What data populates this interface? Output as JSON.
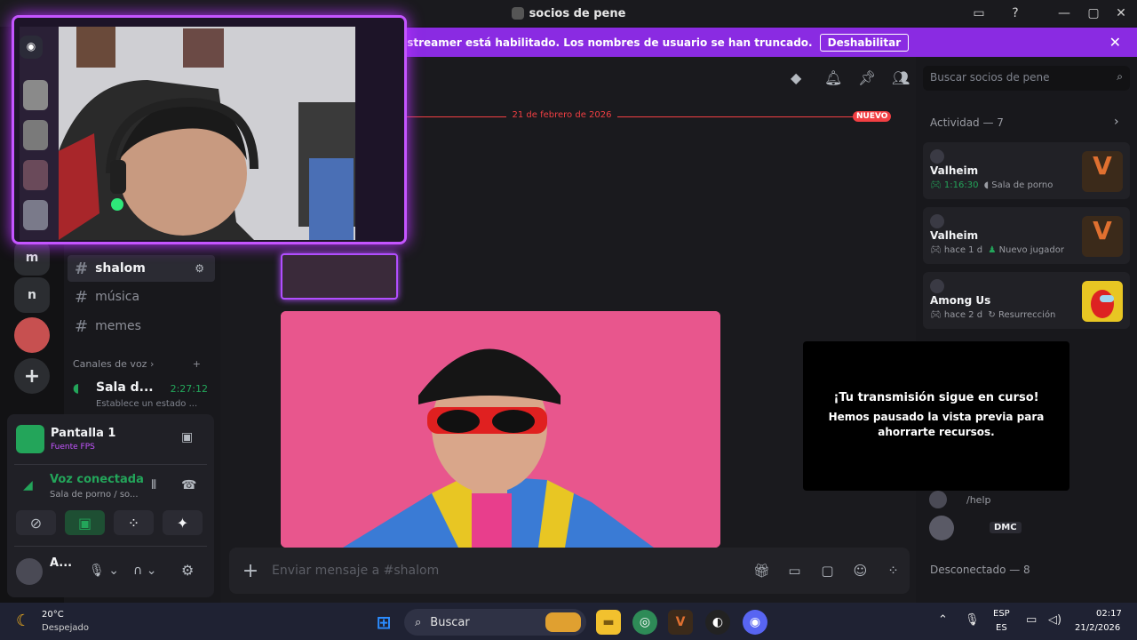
{
  "window": {
    "title": "socios de pene"
  },
  "banner": {
    "text": "El modo streamer está habilitado. Los nombres de usuario se han truncado.",
    "button": "Deshabilitar"
  },
  "rail": {
    "items": [
      "m",
      "n"
    ]
  },
  "channels": {
    "items": [
      {
        "label": "shalom",
        "active": true
      },
      {
        "label": "música"
      },
      {
        "label": "memes"
      }
    ],
    "voice_category": "Canales de voz",
    "voice_channel": {
      "label": "Sala d...",
      "timer": "2:27:12",
      "status": "Establece un estado ..."
    }
  },
  "panel": {
    "screen_label": "Pantalla 1",
    "screen_sub": "Fuente FPS",
    "voice_title": "Voz conectada",
    "voice_sub": "Sala de porno / so...",
    "user_name": "A..."
  },
  "main": {
    "date_divider": "21 de febrero de 2026",
    "new_badge": "NUEVO",
    "composer_placeholder": "Enviar mensaje a #shalom"
  },
  "right": {
    "search_placeholder": "Buscar socios de pene",
    "activity_header": "Actividad — 7",
    "cards": [
      {
        "user": "",
        "game": "Valheim",
        "meta1": "1:16:30",
        "meta2": "Sala de porno",
        "thumb_color": "#3b2a1a",
        "thumb_glyph": "V"
      },
      {
        "user": "",
        "game": "Valheim",
        "meta1": "hace 1 d",
        "meta2": "Nuevo jugador",
        "thumb_color": "#3b2a1a",
        "thumb_glyph": "V"
      },
      {
        "user": "",
        "game": "Among Us",
        "meta1": "hace 2 d",
        "meta2": "Resurrección",
        "thumb_color": "#e8c623",
        "thumb_glyph": ""
      }
    ],
    "member_help": "/help",
    "member_tag": "DMC",
    "offline_header": "Desconectado — 8"
  },
  "preview": {
    "title": "¡Tu transmisión sigue en curso!",
    "body": "Hemos pausado la vista previa para ahorrarte recursos."
  },
  "taskbar": {
    "weather_temp": "20°C",
    "weather_desc": "Despejado",
    "search": "Buscar",
    "lang_top": "ESP",
    "lang_bottom": "ES",
    "time": "02:17",
    "date": "21/2/2026"
  },
  "colors": {
    "accent": "#8a2be2",
    "neon": "#c455ff",
    "online": "#23a55a",
    "danger": "#f23f43"
  }
}
